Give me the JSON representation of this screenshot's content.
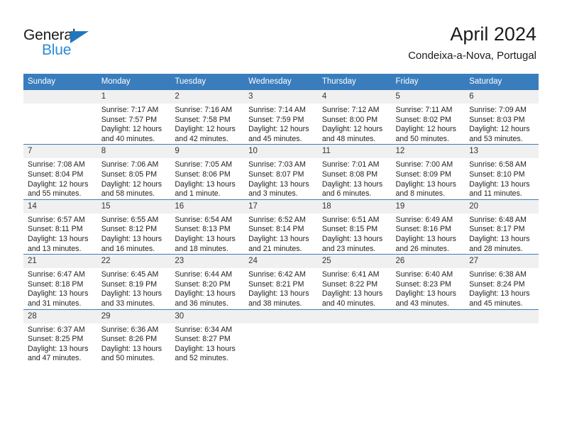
{
  "brand": {
    "name_part1": "General",
    "name_part2": "Blue",
    "triangle_icon": "blue-triangle-icon",
    "accent_color": "#2b8ad6"
  },
  "header": {
    "title": "April 2024",
    "subtitle": "Condeixa-a-Nova, Portugal"
  },
  "colors": {
    "header_blue": "#3a7dbd",
    "daynum_band": "#f0f0f0",
    "text": "#232323"
  },
  "weekday_headers": [
    "Sunday",
    "Monday",
    "Tuesday",
    "Wednesday",
    "Thursday",
    "Friday",
    "Saturday"
  ],
  "weeks": [
    [
      {
        "day": "",
        "sunrise": "",
        "sunset": "",
        "daylight": ""
      },
      {
        "day": "1",
        "sunrise": "Sunrise: 7:17 AM",
        "sunset": "Sunset: 7:57 PM",
        "daylight": "Daylight: 12 hours and 40 minutes."
      },
      {
        "day": "2",
        "sunrise": "Sunrise: 7:16 AM",
        "sunset": "Sunset: 7:58 PM",
        "daylight": "Daylight: 12 hours and 42 minutes."
      },
      {
        "day": "3",
        "sunrise": "Sunrise: 7:14 AM",
        "sunset": "Sunset: 7:59 PM",
        "daylight": "Daylight: 12 hours and 45 minutes."
      },
      {
        "day": "4",
        "sunrise": "Sunrise: 7:12 AM",
        "sunset": "Sunset: 8:00 PM",
        "daylight": "Daylight: 12 hours and 48 minutes."
      },
      {
        "day": "5",
        "sunrise": "Sunrise: 7:11 AM",
        "sunset": "Sunset: 8:02 PM",
        "daylight": "Daylight: 12 hours and 50 minutes."
      },
      {
        "day": "6",
        "sunrise": "Sunrise: 7:09 AM",
        "sunset": "Sunset: 8:03 PM",
        "daylight": "Daylight: 12 hours and 53 minutes."
      }
    ],
    [
      {
        "day": "7",
        "sunrise": "Sunrise: 7:08 AM",
        "sunset": "Sunset: 8:04 PM",
        "daylight": "Daylight: 12 hours and 55 minutes."
      },
      {
        "day": "8",
        "sunrise": "Sunrise: 7:06 AM",
        "sunset": "Sunset: 8:05 PM",
        "daylight": "Daylight: 12 hours and 58 minutes."
      },
      {
        "day": "9",
        "sunrise": "Sunrise: 7:05 AM",
        "sunset": "Sunset: 8:06 PM",
        "daylight": "Daylight: 13 hours and 1 minute."
      },
      {
        "day": "10",
        "sunrise": "Sunrise: 7:03 AM",
        "sunset": "Sunset: 8:07 PM",
        "daylight": "Daylight: 13 hours and 3 minutes."
      },
      {
        "day": "11",
        "sunrise": "Sunrise: 7:01 AM",
        "sunset": "Sunset: 8:08 PM",
        "daylight": "Daylight: 13 hours and 6 minutes."
      },
      {
        "day": "12",
        "sunrise": "Sunrise: 7:00 AM",
        "sunset": "Sunset: 8:09 PM",
        "daylight": "Daylight: 13 hours and 8 minutes."
      },
      {
        "day": "13",
        "sunrise": "Sunrise: 6:58 AM",
        "sunset": "Sunset: 8:10 PM",
        "daylight": "Daylight: 13 hours and 11 minutes."
      }
    ],
    [
      {
        "day": "14",
        "sunrise": "Sunrise: 6:57 AM",
        "sunset": "Sunset: 8:11 PM",
        "daylight": "Daylight: 13 hours and 13 minutes."
      },
      {
        "day": "15",
        "sunrise": "Sunrise: 6:55 AM",
        "sunset": "Sunset: 8:12 PM",
        "daylight": "Daylight: 13 hours and 16 minutes."
      },
      {
        "day": "16",
        "sunrise": "Sunrise: 6:54 AM",
        "sunset": "Sunset: 8:13 PM",
        "daylight": "Daylight: 13 hours and 18 minutes."
      },
      {
        "day": "17",
        "sunrise": "Sunrise: 6:52 AM",
        "sunset": "Sunset: 8:14 PM",
        "daylight": "Daylight: 13 hours and 21 minutes."
      },
      {
        "day": "18",
        "sunrise": "Sunrise: 6:51 AM",
        "sunset": "Sunset: 8:15 PM",
        "daylight": "Daylight: 13 hours and 23 minutes."
      },
      {
        "day": "19",
        "sunrise": "Sunrise: 6:49 AM",
        "sunset": "Sunset: 8:16 PM",
        "daylight": "Daylight: 13 hours and 26 minutes."
      },
      {
        "day": "20",
        "sunrise": "Sunrise: 6:48 AM",
        "sunset": "Sunset: 8:17 PM",
        "daylight": "Daylight: 13 hours and 28 minutes."
      }
    ],
    [
      {
        "day": "21",
        "sunrise": "Sunrise: 6:47 AM",
        "sunset": "Sunset: 8:18 PM",
        "daylight": "Daylight: 13 hours and 31 minutes."
      },
      {
        "day": "22",
        "sunrise": "Sunrise: 6:45 AM",
        "sunset": "Sunset: 8:19 PM",
        "daylight": "Daylight: 13 hours and 33 minutes."
      },
      {
        "day": "23",
        "sunrise": "Sunrise: 6:44 AM",
        "sunset": "Sunset: 8:20 PM",
        "daylight": "Daylight: 13 hours and 36 minutes."
      },
      {
        "day": "24",
        "sunrise": "Sunrise: 6:42 AM",
        "sunset": "Sunset: 8:21 PM",
        "daylight": "Daylight: 13 hours and 38 minutes."
      },
      {
        "day": "25",
        "sunrise": "Sunrise: 6:41 AM",
        "sunset": "Sunset: 8:22 PM",
        "daylight": "Daylight: 13 hours and 40 minutes."
      },
      {
        "day": "26",
        "sunrise": "Sunrise: 6:40 AM",
        "sunset": "Sunset: 8:23 PM",
        "daylight": "Daylight: 13 hours and 43 minutes."
      },
      {
        "day": "27",
        "sunrise": "Sunrise: 6:38 AM",
        "sunset": "Sunset: 8:24 PM",
        "daylight": "Daylight: 13 hours and 45 minutes."
      }
    ],
    [
      {
        "day": "28",
        "sunrise": "Sunrise: 6:37 AM",
        "sunset": "Sunset: 8:25 PM",
        "daylight": "Daylight: 13 hours and 47 minutes."
      },
      {
        "day": "29",
        "sunrise": "Sunrise: 6:36 AM",
        "sunset": "Sunset: 8:26 PM",
        "daylight": "Daylight: 13 hours and 50 minutes."
      },
      {
        "day": "30",
        "sunrise": "Sunrise: 6:34 AM",
        "sunset": "Sunset: 8:27 PM",
        "daylight": "Daylight: 13 hours and 52 minutes."
      },
      {
        "day": "",
        "sunrise": "",
        "sunset": "",
        "daylight": ""
      },
      {
        "day": "",
        "sunrise": "",
        "sunset": "",
        "daylight": ""
      },
      {
        "day": "",
        "sunrise": "",
        "sunset": "",
        "daylight": ""
      },
      {
        "day": "",
        "sunrise": "",
        "sunset": "",
        "daylight": ""
      }
    ]
  ]
}
